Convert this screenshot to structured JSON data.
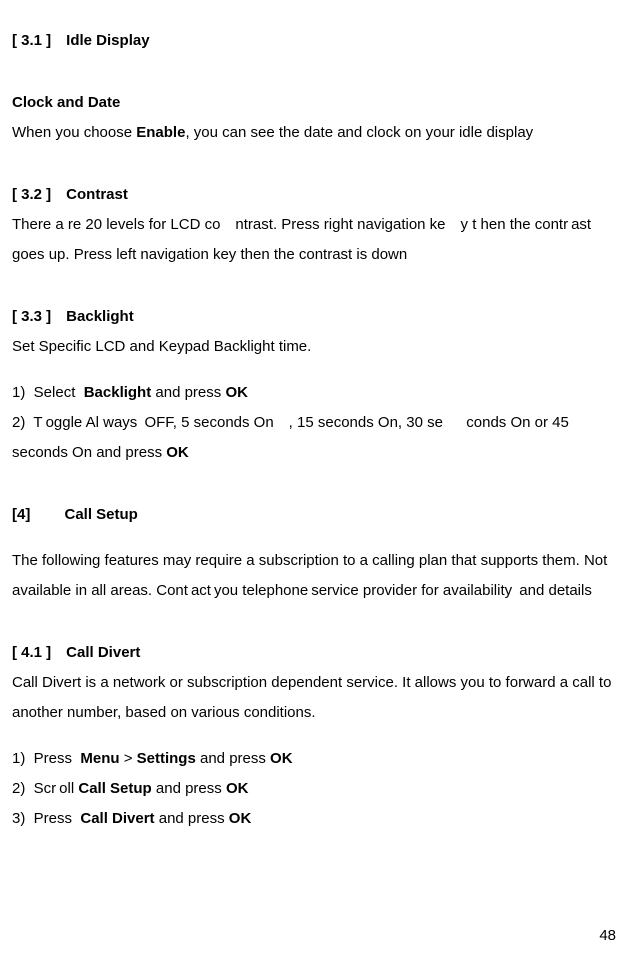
{
  "sec31": {
    "heading": "[ 3.1 ] Idle Display",
    "sub1": "Clock and Date",
    "para1_a": "When you choose ",
    "para1_b": "Enable",
    "para1_c": ", you can see the date and clock on your idle display"
  },
  "sec32": {
    "heading": "[ 3.2 ] Contrast",
    "para1": "There a re 20 levels for LCD co ntrast. Press right navigation ke y t hen the contr ast goes up. Press left navigation key then the contrast is down"
  },
  "sec33": {
    "heading": "[ 3.3 ] Backlight",
    "para1": "Set Specific LCD and Keypad Backlight time.",
    "l1_pre": "1)  Select  ",
    "l1_b1": "Backlight",
    "l1_mid": " and press ",
    "l1_b2": "OK",
    "l2_pre": "2)  T oggle Al ways  OFF, 5 seconds On , 15 seconds On, 30 se   conds On or 45 seconds On and press ",
    "l2_b1": "OK"
  },
  "sec4": {
    "heading": "[4]   Call Setup",
    "para1": "The following features may require a subscription to a calling plan that supports them. Not available in all areas. Cont act you telephone service provider for availability  and details"
  },
  "sec41": {
    "heading": "[ 4.1 ] Call Divert",
    "para1": "Call Divert is a network or subscription dependent service. It allows you to forward a call to another number, based on various conditions.",
    "l1_pre": "1)  Press  ",
    "l1_b1": "Menu",
    "l1_mid1": " > ",
    "l1_b2": "Settings",
    "l1_mid2": " and press ",
    "l1_b3": "OK",
    "l2_pre": "2)  Scr oll ",
    "l2_b1": "Call Setup",
    "l2_mid": " and press ",
    "l2_b2": "OK",
    "l3_pre": "3)  Press  ",
    "l3_b1": "Call Divert",
    "l3_mid": " and press ",
    "l3_b2": "OK"
  },
  "page_number": "48"
}
